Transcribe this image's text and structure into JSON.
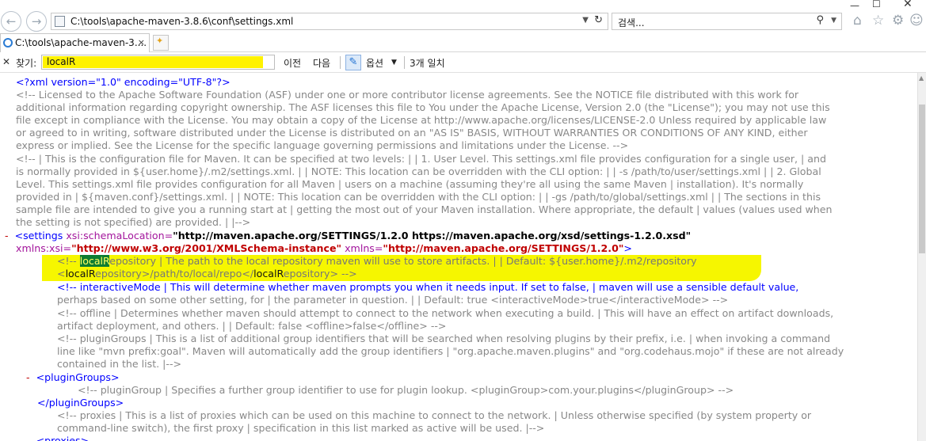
{
  "address_bar": {
    "url": "C:\\tools\\apache-maven-3.8.6\\conf\\settings.xml"
  },
  "search_box": {
    "placeholder": "검색..."
  },
  "tab": {
    "label": "C:\\tools\\apache-maven-3....",
    "close": "×"
  },
  "find_bar": {
    "label": "찾기:",
    "value": "localR",
    "prev_label": "이전",
    "next_label": "다음",
    "options_label": "옵션",
    "match_count": "3개 일치"
  },
  "xml": {
    "l1": "<?xml version=\"1.0\" encoding=\"UTF-8\"?>",
    "l2": "<!-- Licensed to the Apache Software Foundation (ASF) under one or more contributor license agreements. See the NOTICE file distributed with this work for",
    "l3": "additional information regarding copyright ownership. The ASF licenses this file to You under the Apache License, Version 2.0 (the \"License\"); you may not use this",
    "l4": "file except in compliance with the License. You may obtain a copy of the License at http://www.apache.org/licenses/LICENSE-2.0 Unless required by applicable law",
    "l5": "or agreed to in writing, software distributed under the License is distributed on an \"AS IS\" BASIS, WITHOUT WARRANTIES OR CONDITIONS OF ANY KIND, either",
    "l6": "express or implied. See the License for the specific language governing permissions and limitations under the License. -->",
    "l7": "<!-- | This is the configuration file for Maven. It can be specified at two levels: | | 1. User Level. This settings.xml file provides configuration for a single user, | and",
    "l8": "is normally provided in ${user.home}/.m2/settings.xml. | | NOTE: This location can be overridden with the CLI option: | | -s /path/to/user/settings.xml | | 2. Global",
    "l9": "Level. This settings.xml file provides configuration for all Maven | users on a machine (assuming they're all using the same Maven | installation). It's normally",
    "l10": "provided in | ${maven.conf}/settings.xml. | | NOTE: This location can be overridden with the CLI option: | | -gs /path/to/global/settings.xml | | The sections in this",
    "l11": "sample file are intended to give you a running start at | getting the most out of your Maven installation. Where appropriate, the default | values (values used when",
    "l12": "the setting is not specified) are provided. | |-->",
    "settings_open": "<settings",
    "schema_attr": "xsi:schemaLocation=",
    "schema_val": "\"http://maven.apache.org/SETTINGS/1.2.0 https://maven.apache.org/xsd/settings-1.2.0.xsd\"",
    "xmlns_xsi_attr": "xmlns:xsi=",
    "xmlns_xsi_val": "\"http://www.w3.org/2001/XMLSchema-instance\"",
    "xmlns_attr": "xmlns=",
    "xmlns_val": "\"http://maven.apache.org/SETTINGS/1.2.0\"",
    "close_gt": ">",
    "lr_open": "<!-- ",
    "lr_hit": "localR",
    "lr_rest": "epository | The path to the local repository maven will use to store artifacts. | | Default: ${user.home}/.m2/repository",
    "lr2_a": "<",
    "lr2_b": "localR",
    "lr2_c": "epository>/path/to/local/repo</",
    "lr2_d": "localR",
    "lr2_e": "epository> -->",
    "im1": "<!-- interactiveMode | This will determine whether maven prompts you when it needs input. If set to false, | maven will use a sensible default value,",
    "im2": "perhaps based on some other setting, for | the parameter in question. | | Default: true <interactiveMode>true</interactiveMode> -->",
    "of1": "<!-- offline | Determines whether maven should attempt to connect to the network when executing a build. | This will have an effect on artifact downloads,",
    "of2": "artifact deployment, and others. | | Default: false <offline>false</offline> -->",
    "pg1": "<!-- pluginGroups | This is a list of additional group identifiers that will be searched when resolving plugins by their prefix, i.e. | when invoking a command",
    "pg2": "line like \"mvn prefix:goal\". Maven will automatically add the group identifiers | \"org.apache.maven.plugins\" and \"org.codehaus.mojo\" if these are not already",
    "pg3": "contained in the list. |-->",
    "plugin_groups_open": "<pluginGroups>",
    "pgc": "<!-- pluginGroup | Specifies a further group identifier to use for plugin lookup. <pluginGroup>com.your.plugins</pluginGroup> -->",
    "plugin_groups_close": "</pluginGroups>",
    "px1": "<!-- proxies | This is a list of proxies which can be used on this machine to connect to the network. | Unless otherwise specified (by system property or",
    "px2": "command-line switch), the first proxy | specification in this list marked as active will be used. |-->",
    "proxies_open": "<proxies>",
    "minus": "-"
  }
}
